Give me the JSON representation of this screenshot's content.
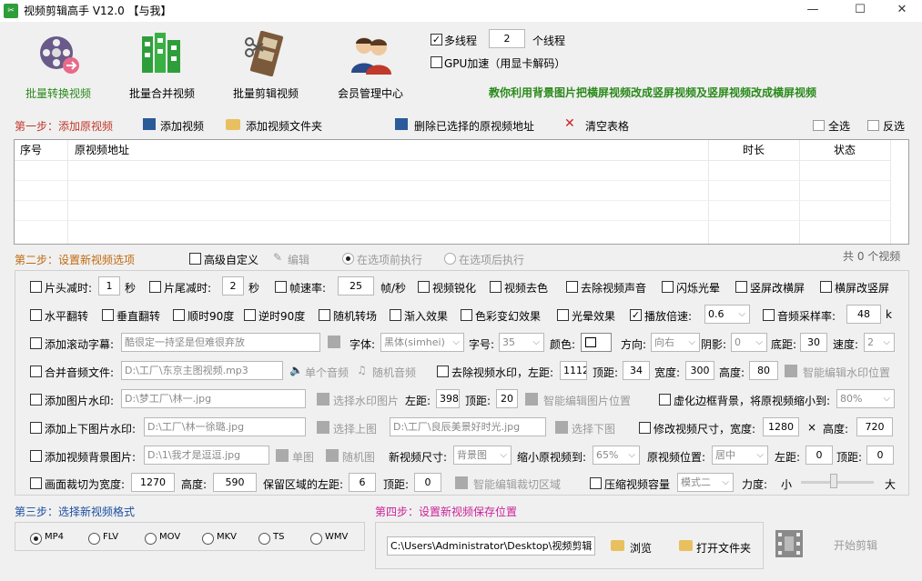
{
  "title": "视频剪辑高手 V12.0  【与我】",
  "toolbar": {
    "batch_convert": "批量转换视频",
    "batch_merge": "批量合并视频",
    "batch_edit": "批量剪辑视频",
    "member": "会员管理中心"
  },
  "multithread": {
    "label": "多线程",
    "value": "2",
    "unit": "个线程"
  },
  "gpu_label": "GPU加速（用显卡解码）",
  "promo": "教你利用背景图片把横屏视频改成竖屏视频及竖屏视频改成横屏视频",
  "step1": {
    "title": "第一步：添加原视频",
    "add_video": "添加视频",
    "add_folder": "添加视频文件夹",
    "delete_selected": "删除已选择的原视频地址",
    "clear_table": "清空表格",
    "select_all": "全选",
    "invert": "反选"
  },
  "table": {
    "columns": [
      "序号",
      "原视频地址",
      "时长",
      "状态"
    ]
  },
  "step2": {
    "title": "第二步：设置新视频选项",
    "advanced": "高级自定义",
    "edit": "编辑",
    "before": "在选项前执行",
    "after": "在选项后执行",
    "count": "共 0 个视频"
  },
  "opts": {
    "head_cut": "片头减时:",
    "head_val": "1",
    "sec": "秒",
    "tail_cut": "片尾减时:",
    "tail_val": "2",
    "frame_rate": "帧速率:",
    "frame_val": "25",
    "fps": "帧/秒",
    "sharpen": "视频锐化",
    "decolor": "视频去色",
    "remove_audio": "去除视频声音",
    "flash": "闪烁光晕",
    "v2h": "竖屏改横屏",
    "h2v": "横屏改竖屏",
    "hflip": "水平翻转",
    "vflip": "垂直翻转",
    "cw90": "顺时90度",
    "ccw90": "逆时90度",
    "random_trans": "随机转场",
    "fade_in": "渐入效果",
    "color_change": "色彩变幻效果",
    "halo": "光晕效果",
    "speed": "播放倍速:",
    "speed_val": "0.6",
    "sample_rate": "音频采样率:",
    "sample_val": "48",
    "k": "k",
    "scroll_sub": "添加滚动字幕:",
    "sub_text": "酷很定一持坚是但难很弃放",
    "font": "字体:",
    "font_val": "黑体(simhei)",
    "size": "字号:",
    "size_val": "35",
    "color": "颜色:",
    "dir": "方向:",
    "dir_val": "向右",
    "shadow": "阴影:",
    "shadow_val": "0",
    "bottom": "底距:",
    "bottom_val": "30",
    "spd": "速度:",
    "spd_val": "2",
    "merge_audio": "合并音频文件:",
    "audio_path": "D:\\工厂\\东京主图视频.mp3",
    "single_audio": "单个音频",
    "random_audio": "随机音频",
    "remove_wm": "去除视频水印，左距:",
    "wm_left": "1112",
    "top": "顶距:",
    "wm_top": "34",
    "width": "宽度:",
    "wm_w": "300",
    "height": "高度:",
    "wm_h": "80",
    "smart_wm": "智能编辑水印位置",
    "img_wm": "添加图片水印:",
    "img_path": "D:\\梦工厂\\林一.jpg",
    "select_wm": "选择水印图片",
    "left": "左距:",
    "img_left": "398",
    "img_top": "20",
    "smart_img": "智能编辑图片位置",
    "blur_border": "虚化边框背景，将原视频缩小到:",
    "blur_val": "80%",
    "updown_wm": "添加上下图片水印:",
    "up_path": "D:\\工厂\\林一徐璐.jpg",
    "select_up": "选择上图",
    "down_path": "D:\\工厂\\良辰美景好时光.jpg",
    "select_down": "选择下图",
    "resize": "修改视频尺寸，宽度:",
    "resize_w": "1280",
    "x": "×",
    "height2": "高度:",
    "resize_h": "720",
    "bg_img": "添加视频背景图片:",
    "bg_path": "D:\\1\\我才是逗逗.jpg",
    "single_img": "单图",
    "random_img": "随机图",
    "new_size": "新视频尺寸:",
    "new_size_val": "背景图",
    "shrink": "缩小原视频到:",
    "shrink_val": "65%",
    "pos": "原视频位置:",
    "pos_val": "居中",
    "bg_left": "0",
    "bg_top": "0",
    "crop": "画面裁切为宽度:",
    "crop_w": "1270",
    "crop_h": "590",
    "keep_left": "保留区域的左距:",
    "keep_left_val": "6",
    "crop_top": "0",
    "smart_crop": "智能编辑裁切区域",
    "compress": "压缩视频容量",
    "mode": "模式二",
    "strength": "力度:",
    "small": "小",
    "big": "大"
  },
  "step3": {
    "title": "第三步：选择新视频格式",
    "formats": [
      "MP4",
      "FLV",
      "MOV",
      "MKV",
      "TS",
      "WMV"
    ]
  },
  "step4": {
    "title": "第四步：设置新视频保存位置",
    "path": "C:\\Users\\Administrator\\Desktop\\视频剪辑",
    "browse": "浏览",
    "open_folder": "打开文件夹",
    "start": "开始剪辑"
  },
  "colors": {
    "green": "#2a8a1a",
    "red": "#c0392b",
    "blue": "#1a4fa0",
    "magenta": "#cc2299"
  }
}
